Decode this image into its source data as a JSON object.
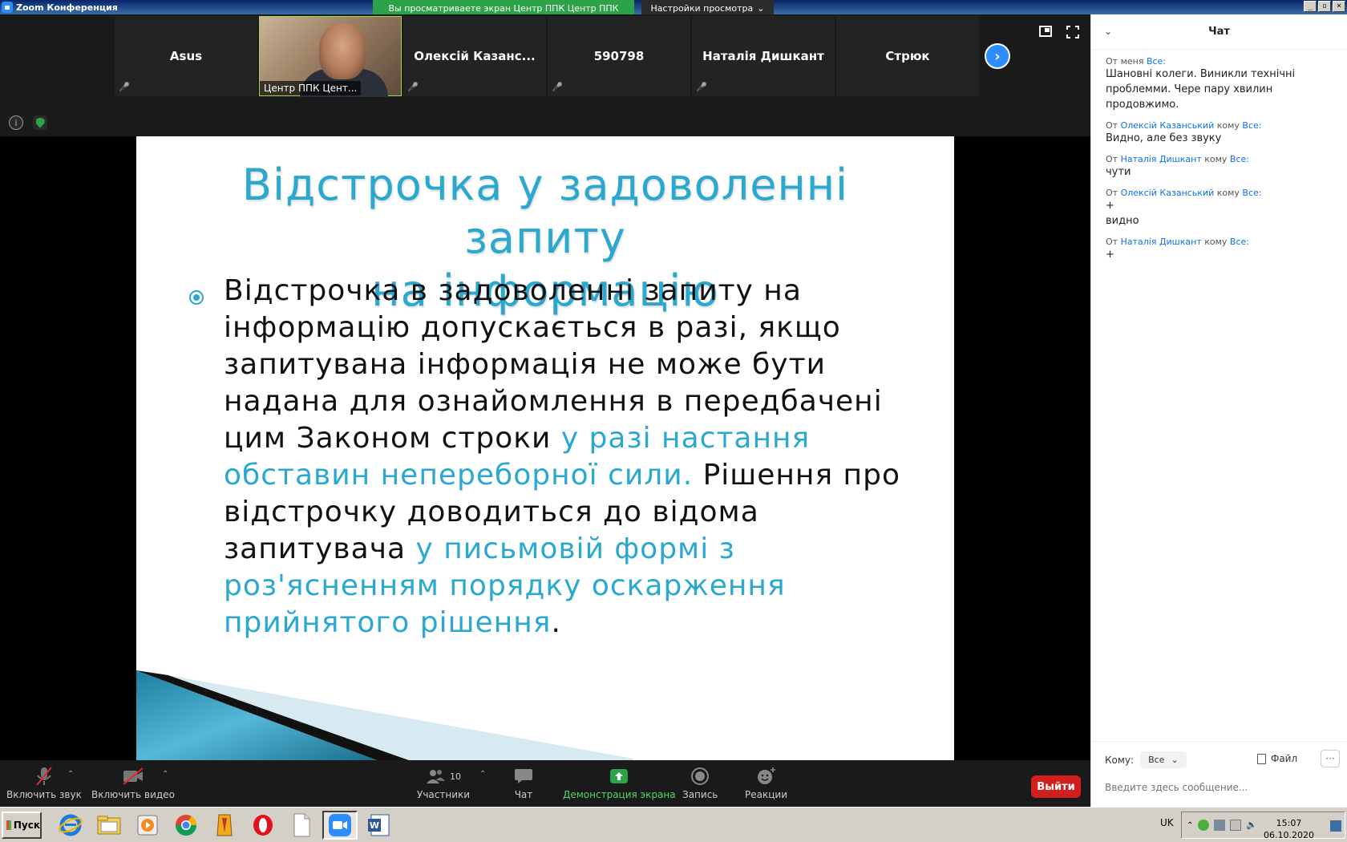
{
  "window": {
    "title": "Zoom Конференция"
  },
  "share_banner": "Вы просматриваете экран Центр ППК Центр ППК",
  "view_options": "Настройки просмотра",
  "participants": [
    {
      "name": "Asus",
      "video": false
    },
    {
      "name": "Центр ППК Цент...",
      "video": true
    },
    {
      "name": "Олексій Казанс...",
      "video": false
    },
    {
      "name": "590798",
      "video": false
    },
    {
      "name": "Наталія Дишкант",
      "video": false
    },
    {
      "name": "Стрюк",
      "video": false
    }
  ],
  "slide": {
    "title_line1": "Відстрочка у задоволенні запиту",
    "title_line2": "на інформацію",
    "bullet_part1": "Відстрочка в задоволенні запиту на інформацію допускається в разі, якщо запитувана інформація не може бути надана для ознайомлення в передбачені цим Законом строки ",
    "bullet_hl1": "у разі настання обставин непереборної сили.",
    "bullet_part2": " Рішення про відстрочку доводиться до відома запитувача ",
    "bullet_hl2": "у письмовій формі з роз'ясненням порядку оскарження прийнятого рішення",
    "bullet_end": "."
  },
  "toolbar": {
    "audio": "Включить звук",
    "video": "Включить видео",
    "participants_label": "Участники",
    "participants_count": "10",
    "chat": "Чат",
    "share": "Демонстрация экрана",
    "record": "Запись",
    "reactions": "Реакции",
    "leave": "Выйти"
  },
  "chat": {
    "title": "Чат",
    "to_label": "Кому:",
    "to_value": "Все",
    "file_label": "Файл",
    "more": "···",
    "placeholder": "Введите здесь сообщение...",
    "messages": [
      {
        "from": "От меня",
        "to_word": "",
        "to": "Все:",
        "sender": "",
        "text": "Шановні колеги. Виникли технічні проблемми. Чере пару хвилин продовжимо."
      },
      {
        "from": "От",
        "sender": "Олексій Казанський",
        "to_word": "кому",
        "to": "Все:",
        "text": "Видно, але без звуку"
      },
      {
        "from": "От",
        "sender": "Наталія Дишкант",
        "to_word": "кому",
        "to": "Все:",
        "text": "чути"
      },
      {
        "from": "От",
        "sender": "Олексій Казанський",
        "to_word": "кому",
        "to": "Все:",
        "text": "+\nвидно"
      },
      {
        "from": "От",
        "sender": "Наталія Дишкант",
        "to_word": "кому",
        "to": "Все:",
        "text": "+"
      }
    ]
  },
  "taskbar": {
    "start": "Пуск",
    "lang": "UK",
    "time": "15:07",
    "date": "06.10.2020"
  },
  "colors": {
    "accent_blue": "#2aa8d0",
    "zoom_blue": "#2d8cff",
    "share_green": "#2da349",
    "leave_red": "#d11f1f"
  }
}
